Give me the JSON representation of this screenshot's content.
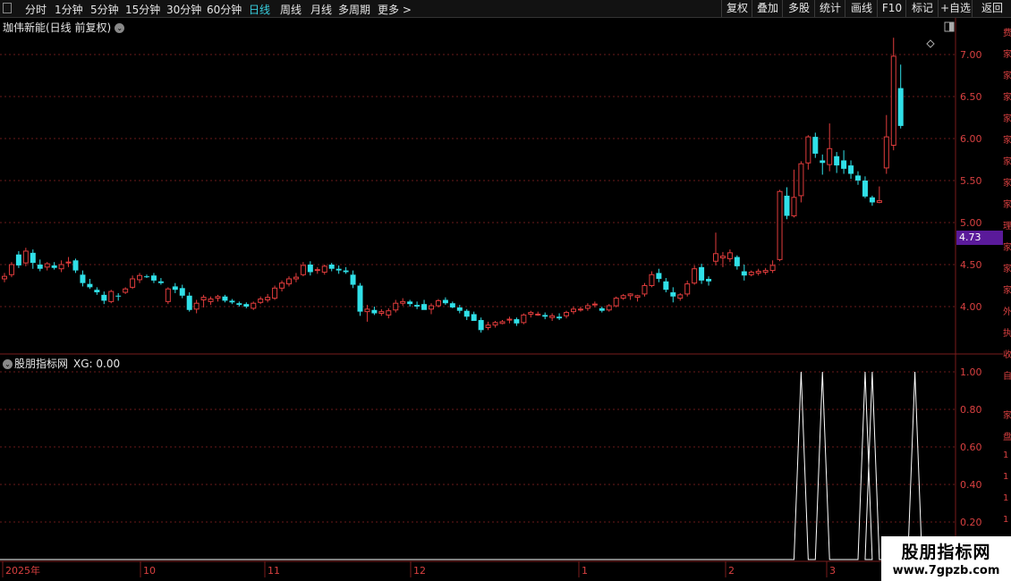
{
  "toolbar": {
    "periods": [
      "分时",
      "1分钟",
      "5分钟",
      "15分钟",
      "30分钟",
      "60分钟",
      "日线",
      "周线",
      "月线",
      "多周期",
      "更多 >"
    ],
    "active_period": "日线",
    "buttons": [
      "复权",
      "叠加",
      "多股",
      "统计",
      "画线",
      "F10",
      "标记",
      "+自选",
      "返回"
    ]
  },
  "main_chart": {
    "title": "珈伟新能(日线 前复权)",
    "price_tag": "4.73",
    "y_ticks": [
      "7.00",
      "6.50",
      "6.00",
      "5.50",
      "5.00",
      "4.50",
      "4.00"
    ]
  },
  "indicator": {
    "name": "股朋指标网",
    "xg_label": "XG: 0.00",
    "y_ticks": [
      "1.00",
      "0.80",
      "0.60",
      "0.40",
      "0.20"
    ]
  },
  "date_axis": {
    "labels": [
      "2025年",
      "10",
      "11",
      "12",
      "1",
      "2",
      "3"
    ]
  },
  "watermark": {
    "title": "股朋指标网",
    "url": "www.7gpzb.com"
  },
  "right_strip_chars": [
    "费",
    "家",
    "家",
    "家",
    "家",
    "家",
    "家",
    "家",
    "家",
    "理",
    "家",
    "家",
    "家",
    "外",
    "执",
    "收",
    "自",
    "家",
    "盘",
    "1",
    "1",
    "1",
    "1"
  ],
  "colors": {
    "up": "#e03c3c",
    "down": "#30e0e8",
    "grid": "#6a1a1a",
    "axis": "#d84040",
    "xg_line": "#ffffff"
  },
  "chart_data": {
    "type": "candlestick",
    "ylim": [
      3.55,
      7.25
    ],
    "candles": [
      [
        4.33,
        4.4,
        4.29,
        4.36
      ],
      [
        4.38,
        4.53,
        4.35,
        4.5
      ],
      [
        4.62,
        4.66,
        4.46,
        4.49
      ],
      [
        4.52,
        4.7,
        4.48,
        4.66
      ],
      [
        4.64,
        4.68,
        4.45,
        4.52
      ],
      [
        4.5,
        4.56,
        4.42,
        4.45
      ],
      [
        4.47,
        4.53,
        4.43,
        4.51
      ],
      [
        4.49,
        4.53,
        4.44,
        4.46
      ],
      [
        4.45,
        4.55,
        4.41,
        4.5
      ],
      [
        4.52,
        4.59,
        4.47,
        4.53
      ],
      [
        4.55,
        4.57,
        4.4,
        4.43
      ],
      [
        4.38,
        4.43,
        4.24,
        4.28
      ],
      [
        4.27,
        4.33,
        4.21,
        4.23
      ],
      [
        4.2,
        4.23,
        4.14,
        4.17
      ],
      [
        4.14,
        4.18,
        4.03,
        4.07
      ],
      [
        4.06,
        4.2,
        4.04,
        4.18
      ],
      [
        4.13,
        4.16,
        4.07,
        4.12
      ],
      [
        4.17,
        4.23,
        4.15,
        4.21
      ],
      [
        4.23,
        4.37,
        4.21,
        4.33
      ],
      [
        4.32,
        4.4,
        4.28,
        4.37
      ],
      [
        4.36,
        4.38,
        4.34,
        4.35
      ],
      [
        4.37,
        4.4,
        4.28,
        4.31
      ],
      [
        4.3,
        4.34,
        4.26,
        4.28
      ],
      [
        4.06,
        4.23,
        4.03,
        4.21
      ],
      [
        4.24,
        4.28,
        4.16,
        4.2
      ],
      [
        4.22,
        4.26,
        4.1,
        4.13
      ],
      [
        4.13,
        4.17,
        3.94,
        3.96
      ],
      [
        3.97,
        4.08,
        3.92,
        4.04
      ],
      [
        4.08,
        4.14,
        3.99,
        4.11
      ],
      [
        4.06,
        4.12,
        4.02,
        4.09
      ],
      [
        4.1,
        4.14,
        4.06,
        4.12
      ],
      [
        4.12,
        4.14,
        4.05,
        4.07
      ],
      [
        4.07,
        4.09,
        4.03,
        4.05
      ],
      [
        4.04,
        4.06,
        4.0,
        4.02
      ],
      [
        4.03,
        4.05,
        3.98,
        4.0
      ],
      [
        3.98,
        4.06,
        3.96,
        4.04
      ],
      [
        4.05,
        4.12,
        4.03,
        4.09
      ],
      [
        4.08,
        4.15,
        4.05,
        4.11
      ],
      [
        4.1,
        4.25,
        4.08,
        4.22
      ],
      [
        4.22,
        4.31,
        4.18,
        4.28
      ],
      [
        4.27,
        4.36,
        4.24,
        4.33
      ],
      [
        4.33,
        4.4,
        4.29,
        4.35
      ],
      [
        4.38,
        4.53,
        4.36,
        4.49
      ],
      [
        4.5,
        4.54,
        4.37,
        4.41
      ],
      [
        4.43,
        4.47,
        4.39,
        4.44
      ],
      [
        4.41,
        4.5,
        4.38,
        4.48
      ],
      [
        4.5,
        4.52,
        4.42,
        4.45
      ],
      [
        4.45,
        4.49,
        4.39,
        4.43
      ],
      [
        4.43,
        4.47,
        4.39,
        4.41
      ],
      [
        4.38,
        4.43,
        4.22,
        4.26
      ],
      [
        4.25,
        4.28,
        3.89,
        3.94
      ],
      [
        3.94,
        4.02,
        3.82,
        3.97
      ],
      [
        3.96,
        4.0,
        3.9,
        3.92
      ],
      [
        3.92,
        3.97,
        3.89,
        3.94
      ],
      [
        3.9,
        3.98,
        3.86,
        3.95
      ],
      [
        3.96,
        4.08,
        3.93,
        4.04
      ],
      [
        4.04,
        4.1,
        4.01,
        4.06
      ],
      [
        4.06,
        4.08,
        4.0,
        4.03
      ],
      [
        4.02,
        4.06,
        3.97,
        4.0
      ],
      [
        4.03,
        4.08,
        3.98,
        3.96
      ],
      [
        3.97,
        4.04,
        3.91,
        4.01
      ],
      [
        4.01,
        4.09,
        3.99,
        4.07
      ],
      [
        4.08,
        4.11,
        4.02,
        4.04
      ],
      [
        4.04,
        4.06,
        3.98,
        3.99
      ],
      [
        3.99,
        4.02,
        3.92,
        3.95
      ],
      [
        3.95,
        3.97,
        3.84,
        3.88
      ],
      [
        3.91,
        3.94,
        3.83,
        3.83
      ],
      [
        3.84,
        3.87,
        3.69,
        3.72
      ],
      [
        3.75,
        3.82,
        3.72,
        3.78
      ],
      [
        3.78,
        3.83,
        3.75,
        3.81
      ],
      [
        3.8,
        3.84,
        3.79,
        3.82
      ],
      [
        3.84,
        3.88,
        3.8,
        3.85
      ],
      [
        3.85,
        3.87,
        3.77,
        3.8
      ],
      [
        3.81,
        3.92,
        3.79,
        3.9
      ],
      [
        3.91,
        3.95,
        3.87,
        3.93
      ],
      [
        3.91,
        3.94,
        3.89,
        3.91
      ],
      [
        3.9,
        3.93,
        3.85,
        3.88
      ],
      [
        3.87,
        3.92,
        3.83,
        3.89
      ],
      [
        3.88,
        3.92,
        3.84,
        3.86
      ],
      [
        3.89,
        3.95,
        3.86,
        3.93
      ],
      [
        3.94,
        4.0,
        3.91,
        3.97
      ],
      [
        3.96,
        4.0,
        3.94,
        3.97
      ],
      [
        3.98,
        4.04,
        3.95,
        4.01
      ],
      [
        4.02,
        4.06,
        3.99,
        4.03
      ],
      [
        3.98,
        4.0,
        3.93,
        3.95
      ],
      [
        3.96,
        4.03,
        3.94,
        4.01
      ],
      [
        4.01,
        4.12,
        3.99,
        4.1
      ],
      [
        4.1,
        4.15,
        4.08,
        4.13
      ],
      [
        4.13,
        4.16,
        4.08,
        4.15
      ],
      [
        4.11,
        4.14,
        4.06,
        4.13
      ],
      [
        4.15,
        4.28,
        4.12,
        4.25
      ],
      [
        4.25,
        4.42,
        4.23,
        4.38
      ],
      [
        4.4,
        4.45,
        4.29,
        4.33
      ],
      [
        4.3,
        4.34,
        4.17,
        4.2
      ],
      [
        4.17,
        4.23,
        4.05,
        4.12
      ],
      [
        4.1,
        4.16,
        4.07,
        4.14
      ],
      [
        4.15,
        4.31,
        4.12,
        4.27
      ],
      [
        4.28,
        4.49,
        4.26,
        4.45
      ],
      [
        4.47,
        4.51,
        4.27,
        4.31
      ],
      [
        4.33,
        4.36,
        4.25,
        4.3
      ],
      [
        4.54,
        4.88,
        4.49,
        4.63
      ],
      [
        4.58,
        4.65,
        4.47,
        4.6
      ],
      [
        4.57,
        4.68,
        4.53,
        4.64
      ],
      [
        4.59,
        4.61,
        4.44,
        4.48
      ],
      [
        4.42,
        4.5,
        4.31,
        4.37
      ],
      [
        4.38,
        4.43,
        4.36,
        4.41
      ],
      [
        4.4,
        4.45,
        4.37,
        4.42
      ],
      [
        4.41,
        4.46,
        4.38,
        4.43
      ],
      [
        4.43,
        4.55,
        4.4,
        4.49
      ],
      [
        4.56,
        5.39,
        4.54,
        5.37
      ],
      [
        5.32,
        5.42,
        5.04,
        5.08
      ],
      [
        5.08,
        5.63,
        5.06,
        5.3
      ],
      [
        5.32,
        5.73,
        5.24,
        5.7
      ],
      [
        5.71,
        6.04,
        5.63,
        6.02
      ],
      [
        6.02,
        6.07,
        5.77,
        5.82
      ],
      [
        5.74,
        5.81,
        5.57,
        5.71
      ],
      [
        5.69,
        6.18,
        5.61,
        5.88
      ],
      [
        5.79,
        5.84,
        5.59,
        5.68
      ],
      [
        5.74,
        5.86,
        5.58,
        5.64
      ],
      [
        5.68,
        5.74,
        5.52,
        5.58
      ],
      [
        5.56,
        5.61,
        5.45,
        5.5
      ],
      [
        5.5,
        5.55,
        5.29,
        5.31
      ],
      [
        5.3,
        5.32,
        5.2,
        5.24
      ],
      [
        5.24,
        5.43,
        5.23,
        5.26
      ],
      [
        5.65,
        6.28,
        5.58,
        6.02
      ],
      [
        5.92,
        7.2,
        5.86,
        6.98
      ],
      [
        6.6,
        6.88,
        6.12,
        6.15
      ]
    ],
    "xg": {
      "ylim": [
        0,
        1.05
      ],
      "signal_indexes": [
        112,
        115,
        121,
        122,
        128
      ]
    }
  }
}
